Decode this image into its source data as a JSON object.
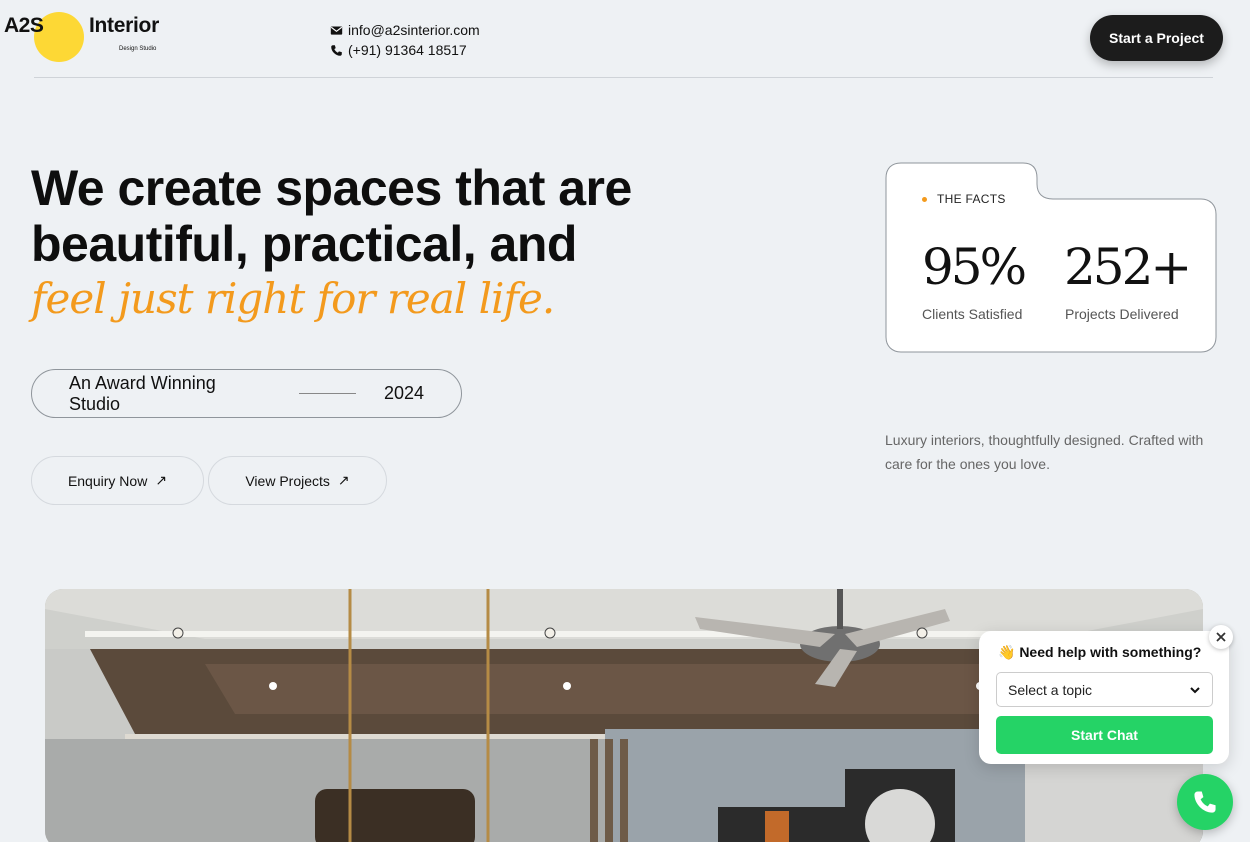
{
  "header": {
    "logo_mark": "A2S",
    "logo_name": "Interior",
    "logo_tagline": "Design Studio",
    "email": "info@a2sinterior.com",
    "phone": "(+91) 91364 18517",
    "cta_label": "Start a Project"
  },
  "hero": {
    "title_line1": "We create spaces that are",
    "title_line2": "beautiful, practical, and",
    "title_italic": "feel just right for real life.",
    "award_label": "An Award Winning Studio",
    "award_year": "2024",
    "enquiry_label": "Enquiry Now",
    "projects_label": "View Projects",
    "accent_color": "#f39a1d"
  },
  "facts": {
    "label": "THE FACTS",
    "items": [
      {
        "value": "95%",
        "caption": "Clients Satisfied"
      },
      {
        "value": "252+",
        "caption": "Projects Delivered"
      }
    ]
  },
  "tagline": "Luxury interiors, thoughtfully designed. Crafted with care for the ones you love.",
  "chat_widget": {
    "title": "👋 Need help with something?",
    "select_value": "Select a topic",
    "button_label": "Start Chat",
    "brand_color": "#25d366",
    "close_icon": "close-icon",
    "launcher_icon": "whatsapp-icon"
  }
}
